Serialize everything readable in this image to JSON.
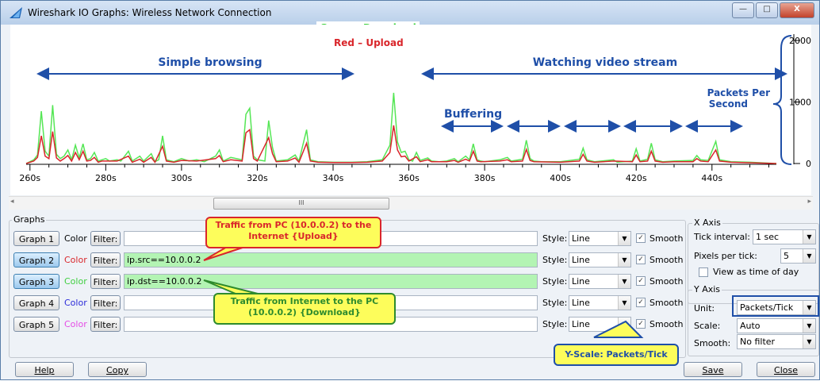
{
  "window": {
    "title": "Wireshark IO Graphs: Wireless Network Connection",
    "min": "—",
    "max": "□",
    "close": "X"
  },
  "annotations": {
    "download_legend": "Green – Download",
    "upload_legend": "Red – Upload",
    "simple_browsing": "Simple browsing",
    "watching_video": "Watching video stream",
    "buffering": "Buffering",
    "packets_per_second": [
      "Packets Per",
      "Second"
    ],
    "upload_callout": [
      "Traffic from PC (10.0.0.2) to the",
      "Internet {Upload}"
    ],
    "download_callout": [
      "Traffic from Internet to the PC",
      "(10.0.0.2) {Download}"
    ],
    "yscale_callout": "Y-Scale: Packets/Tick"
  },
  "colors": {
    "download": "#55e655",
    "upload": "#d9262b",
    "annotation_blue": "#1f4fa8",
    "callout_bg": "#fdfd5b"
  },
  "chart_data": {
    "type": "line",
    "x_ticks": [
      "260s",
      "280s",
      "300s",
      "320s",
      "340s",
      "360s",
      "380s",
      "400s",
      "420s",
      "440s"
    ],
    "y_ticks": [
      "2000",
      "1000",
      "0"
    ],
    "ylim": [
      0,
      2000
    ],
    "xlim": [
      259,
      457
    ],
    "series": [
      {
        "color": "green",
        "points": [
          [
            259,
            0
          ],
          [
            261,
            60
          ],
          [
            262,
            140
          ],
          [
            263,
            850
          ],
          [
            264,
            200
          ],
          [
            265,
            120
          ],
          [
            266,
            950
          ],
          [
            267,
            150
          ],
          [
            268,
            80
          ],
          [
            269,
            120
          ],
          [
            270,
            220
          ],
          [
            271,
            60
          ],
          [
            272,
            300
          ],
          [
            273,
            90
          ],
          [
            274,
            320
          ],
          [
            275,
            60
          ],
          [
            276,
            80
          ],
          [
            277,
            180
          ],
          [
            278,
            40
          ],
          [
            279,
            60
          ],
          [
            280,
            80
          ],
          [
            281,
            40
          ],
          [
            283,
            60
          ],
          [
            284,
            40
          ],
          [
            286,
            200
          ],
          [
            287,
            40
          ],
          [
            289,
            120
          ],
          [
            290,
            40
          ],
          [
            292,
            160
          ],
          [
            293,
            30
          ],
          [
            294,
            60
          ],
          [
            295,
            450
          ],
          [
            296,
            60
          ],
          [
            298,
            30
          ],
          [
            300,
            80
          ],
          [
            302,
            40
          ],
          [
            304,
            60
          ],
          [
            306,
            30
          ],
          [
            309,
            120
          ],
          [
            310,
            220
          ],
          [
            311,
            40
          ],
          [
            313,
            100
          ],
          [
            316,
            60
          ],
          [
            317,
            800
          ],
          [
            318,
            900
          ],
          [
            319,
            120
          ],
          [
            320,
            60
          ],
          [
            322,
            40
          ],
          [
            323,
            700
          ],
          [
            324,
            260
          ],
          [
            325,
            40
          ],
          [
            328,
            60
          ],
          [
            330,
            140
          ],
          [
            331,
            40
          ],
          [
            333,
            550
          ],
          [
            334,
            60
          ],
          [
            336,
            30
          ],
          [
            340,
            20
          ],
          [
            345,
            20
          ],
          [
            349,
            30
          ],
          [
            353,
            60
          ],
          [
            355,
            300
          ],
          [
            356,
            1150
          ],
          [
            357,
            350
          ],
          [
            358,
            180
          ],
          [
            359,
            200
          ],
          [
            360,
            60
          ],
          [
            361,
            40
          ],
          [
            362,
            180
          ],
          [
            363,
            50
          ],
          [
            365,
            90
          ],
          [
            366,
            40
          ],
          [
            368,
            30
          ],
          [
            370,
            40
          ],
          [
            372,
            80
          ],
          [
            373,
            30
          ],
          [
            375,
            120
          ],
          [
            376,
            60
          ],
          [
            377,
            320
          ],
          [
            378,
            60
          ],
          [
            379,
            40
          ],
          [
            380,
            30
          ],
          [
            384,
            60
          ],
          [
            386,
            100
          ],
          [
            387,
            40
          ],
          [
            390,
            70
          ],
          [
            391,
            380
          ],
          [
            392,
            80
          ],
          [
            393,
            40
          ],
          [
            395,
            30
          ],
          [
            400,
            30
          ],
          [
            405,
            70
          ],
          [
            406,
            250
          ],
          [
            407,
            60
          ],
          [
            409,
            30
          ],
          [
            414,
            60
          ],
          [
            415,
            20
          ],
          [
            419,
            40
          ],
          [
            420,
            240
          ],
          [
            421,
            40
          ],
          [
            423,
            70
          ],
          [
            424,
            330
          ],
          [
            425,
            60
          ],
          [
            427,
            30
          ],
          [
            430,
            40
          ],
          [
            435,
            50
          ],
          [
            436,
            130
          ],
          [
            437,
            60
          ],
          [
            439,
            50
          ],
          [
            441,
            360
          ],
          [
            442,
            60
          ],
          [
            445,
            30
          ],
          [
            450,
            20
          ],
          [
            457,
            0
          ]
        ]
      },
      {
        "color": "red",
        "points": [
          [
            259,
            0
          ],
          [
            261,
            40
          ],
          [
            262,
            100
          ],
          [
            263,
            450
          ],
          [
            264,
            120
          ],
          [
            265,
            80
          ],
          [
            266,
            520
          ],
          [
            267,
            90
          ],
          [
            268,
            40
          ],
          [
            269,
            80
          ],
          [
            270,
            130
          ],
          [
            271,
            40
          ],
          [
            272,
            180
          ],
          [
            273,
            60
          ],
          [
            274,
            200
          ],
          [
            275,
            40
          ],
          [
            276,
            50
          ],
          [
            277,
            100
          ],
          [
            278,
            20
          ],
          [
            279,
            40
          ],
          [
            280,
            40
          ],
          [
            283,
            40
          ],
          [
            286,
            120
          ],
          [
            287,
            20
          ],
          [
            289,
            70
          ],
          [
            290,
            20
          ],
          [
            292,
            100
          ],
          [
            293,
            20
          ],
          [
            295,
            280
          ],
          [
            296,
            40
          ],
          [
            298,
            20
          ],
          [
            300,
            50
          ],
          [
            304,
            40
          ],
          [
            309,
            80
          ],
          [
            310,
            130
          ],
          [
            311,
            30
          ],
          [
            313,
            60
          ],
          [
            316,
            40
          ],
          [
            317,
            500
          ],
          [
            318,
            550
          ],
          [
            319,
            80
          ],
          [
            320,
            40
          ],
          [
            323,
            420
          ],
          [
            324,
            160
          ],
          [
            325,
            30
          ],
          [
            328,
            40
          ],
          [
            330,
            90
          ],
          [
            331,
            20
          ],
          [
            333,
            330
          ],
          [
            334,
            40
          ],
          [
            336,
            20
          ],
          [
            340,
            15
          ],
          [
            345,
            15
          ],
          [
            349,
            20
          ],
          [
            353,
            40
          ],
          [
            355,
            180
          ],
          [
            356,
            620
          ],
          [
            357,
            220
          ],
          [
            358,
            110
          ],
          [
            359,
            120
          ],
          [
            360,
            40
          ],
          [
            362,
            110
          ],
          [
            363,
            30
          ],
          [
            365,
            60
          ],
          [
            366,
            30
          ],
          [
            370,
            30
          ],
          [
            372,
            50
          ],
          [
            373,
            20
          ],
          [
            375,
            70
          ],
          [
            376,
            40
          ],
          [
            377,
            200
          ],
          [
            378,
            40
          ],
          [
            379,
            30
          ],
          [
            384,
            40
          ],
          [
            386,
            60
          ],
          [
            387,
            30
          ],
          [
            390,
            40
          ],
          [
            391,
            230
          ],
          [
            392,
            50
          ],
          [
            393,
            30
          ],
          [
            400,
            20
          ],
          [
            405,
            40
          ],
          [
            406,
            150
          ],
          [
            407,
            40
          ],
          [
            409,
            20
          ],
          [
            414,
            40
          ],
          [
            419,
            30
          ],
          [
            420,
            140
          ],
          [
            421,
            30
          ],
          [
            423,
            40
          ],
          [
            424,
            200
          ],
          [
            425,
            40
          ],
          [
            427,
            20
          ],
          [
            430,
            30
          ],
          [
            435,
            30
          ],
          [
            436,
            80
          ],
          [
            437,
            40
          ],
          [
            439,
            30
          ],
          [
            441,
            220
          ],
          [
            442,
            40
          ],
          [
            445,
            20
          ],
          [
            457,
            0
          ]
        ]
      }
    ]
  },
  "graphs": {
    "section_label": "Graphs",
    "color_label": "Color",
    "filter_label": "Filter:",
    "style_label": "Style:",
    "smooth_label": "Smooth",
    "rows": [
      {
        "button": "Graph 1",
        "color": "#000000",
        "filter": "",
        "style": "Line",
        "smooth": "✓"
      },
      {
        "button": "Graph 2",
        "color": "#d9262b",
        "filter": "ip.src==10.0.0.2",
        "style": "Line",
        "smooth": "✓"
      },
      {
        "button": "Graph 3",
        "color": "#3fcf3f",
        "filter": "ip.dst==10.0.0.2",
        "style": "Line",
        "smooth": "✓"
      },
      {
        "button": "Graph 4",
        "color": "#2b2bd9",
        "filter": "",
        "style": "Line",
        "smooth": "✓"
      },
      {
        "button": "Graph 5",
        "color": "#e54be5",
        "filter": "",
        "style": "Line",
        "smooth": "✓"
      }
    ]
  },
  "x_axis": {
    "section_label": "X Axis",
    "tick_interval_label": "Tick interval:",
    "tick_interval_value": "1 sec",
    "pixels_per_tick_label": "Pixels per tick:",
    "pixels_per_tick_value": "5",
    "view_time_label": "View as time of day"
  },
  "y_axis": {
    "section_label": "Y Axis",
    "unit_label": "Unit:",
    "unit_value": "Packets/Tick",
    "scale_label": "Scale:",
    "scale_value": "Auto",
    "smooth_label": "Smooth:",
    "smooth_value": "No filter"
  },
  "buttons": {
    "help": "Help",
    "copy": "Copy",
    "save": "Save",
    "close": "Close"
  },
  "scrollbar": {
    "thumb_grip": "III"
  }
}
